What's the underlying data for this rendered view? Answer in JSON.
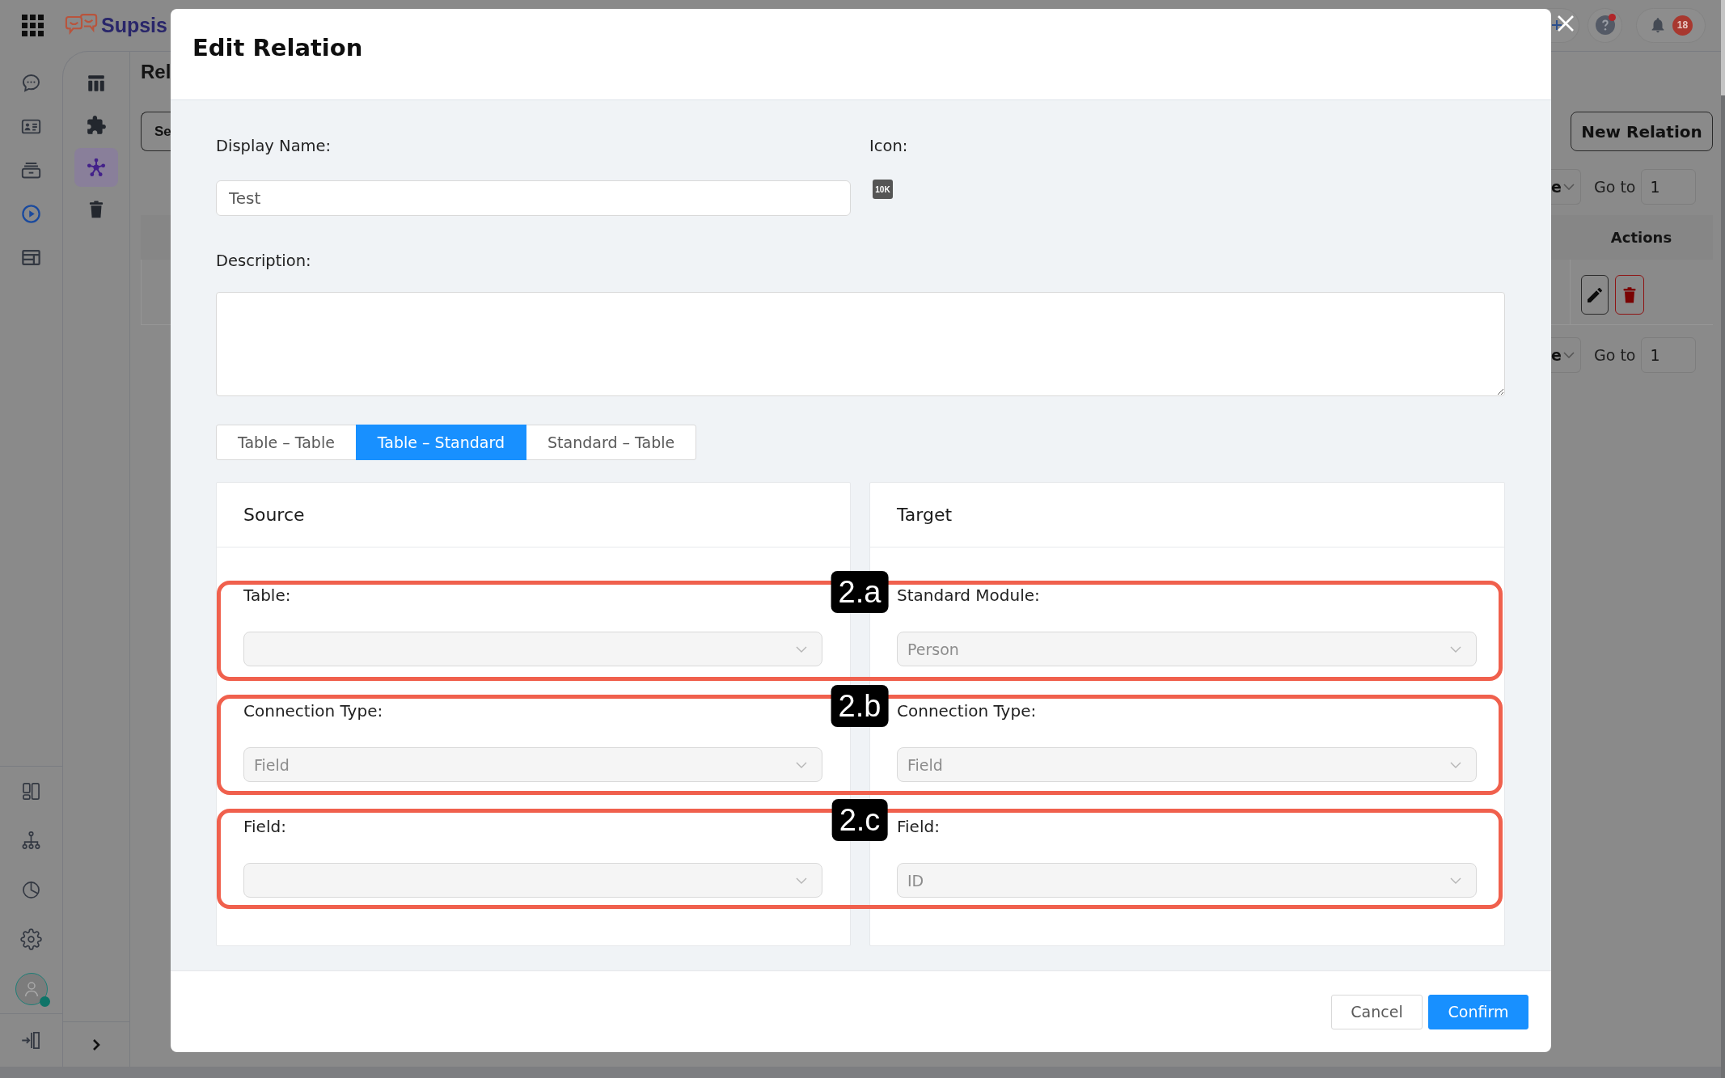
{
  "topbar": {
    "logo_text": "Supsis",
    "help": {
      "unread": true
    },
    "notifications": {
      "count": "18"
    }
  },
  "rail": {
    "items": [
      {
        "selected": false
      },
      {
        "selected": false
      },
      {
        "selected": false
      },
      {
        "selected": true
      },
      {
        "selected": false
      }
    ],
    "bottom_items": [
      {
        "selected": false
      },
      {
        "selected": false
      },
      {
        "selected": false
      },
      {
        "selected": false
      }
    ],
    "user": {
      "online": true
    }
  },
  "subnav": {
    "items": [
      {
        "selected": false
      },
      {
        "selected": false
      },
      {
        "selected": true
      },
      {
        "selected": false
      }
    ]
  },
  "page": {
    "title": "Rel",
    "search_button": "Se",
    "new_button": "New Relation",
    "pagination_top": {
      "page_size": "e",
      "goto_label": "Go to",
      "goto_value": "1"
    },
    "table": {
      "actions_header": "Actions",
      "rows": [
        {
          "actions": [
            {
              "kind": "edit"
            },
            {
              "kind": "delete"
            }
          ]
        }
      ]
    },
    "pagination_bottom": {
      "page_size": "e",
      "goto_label": "Go to",
      "goto_value": "1"
    }
  },
  "modal": {
    "title": "Edit Relation",
    "display_name": {
      "label": "Display Name:",
      "value": "Test"
    },
    "icon": {
      "label": "Icon:",
      "glyph": "10K"
    },
    "description": {
      "label": "Description:"
    },
    "tabs": [
      {
        "label": "Table – Table",
        "selected": false
      },
      {
        "label": "Table – Standard",
        "selected": true
      },
      {
        "label": "Standard – Table",
        "selected": false
      }
    ],
    "panels": [
      {
        "title": "Source",
        "fields": [
          {
            "label": "Table:",
            "disabled": true
          },
          {
            "label": "Connection Type:",
            "value": "Field",
            "disabled": true
          },
          {
            "label": "Field:",
            "disabled": true
          }
        ]
      },
      {
        "title": "Target",
        "fields": [
          {
            "label": "Standard Module:",
            "value": "Person",
            "disabled": true
          },
          {
            "label": "Connection Type:",
            "value": "Field",
            "disabled": true
          },
          {
            "label": "Field:",
            "value": "ID",
            "disabled": true
          }
        ]
      }
    ],
    "buttons": [
      {
        "label": "Cancel",
        "kind": "default"
      },
      {
        "label": "Confirm",
        "kind": "primary"
      }
    ]
  },
  "annotations": [
    {
      "label": "2.a"
    },
    {
      "label": "2.b"
    },
    {
      "label": "2.c"
    }
  ]
}
